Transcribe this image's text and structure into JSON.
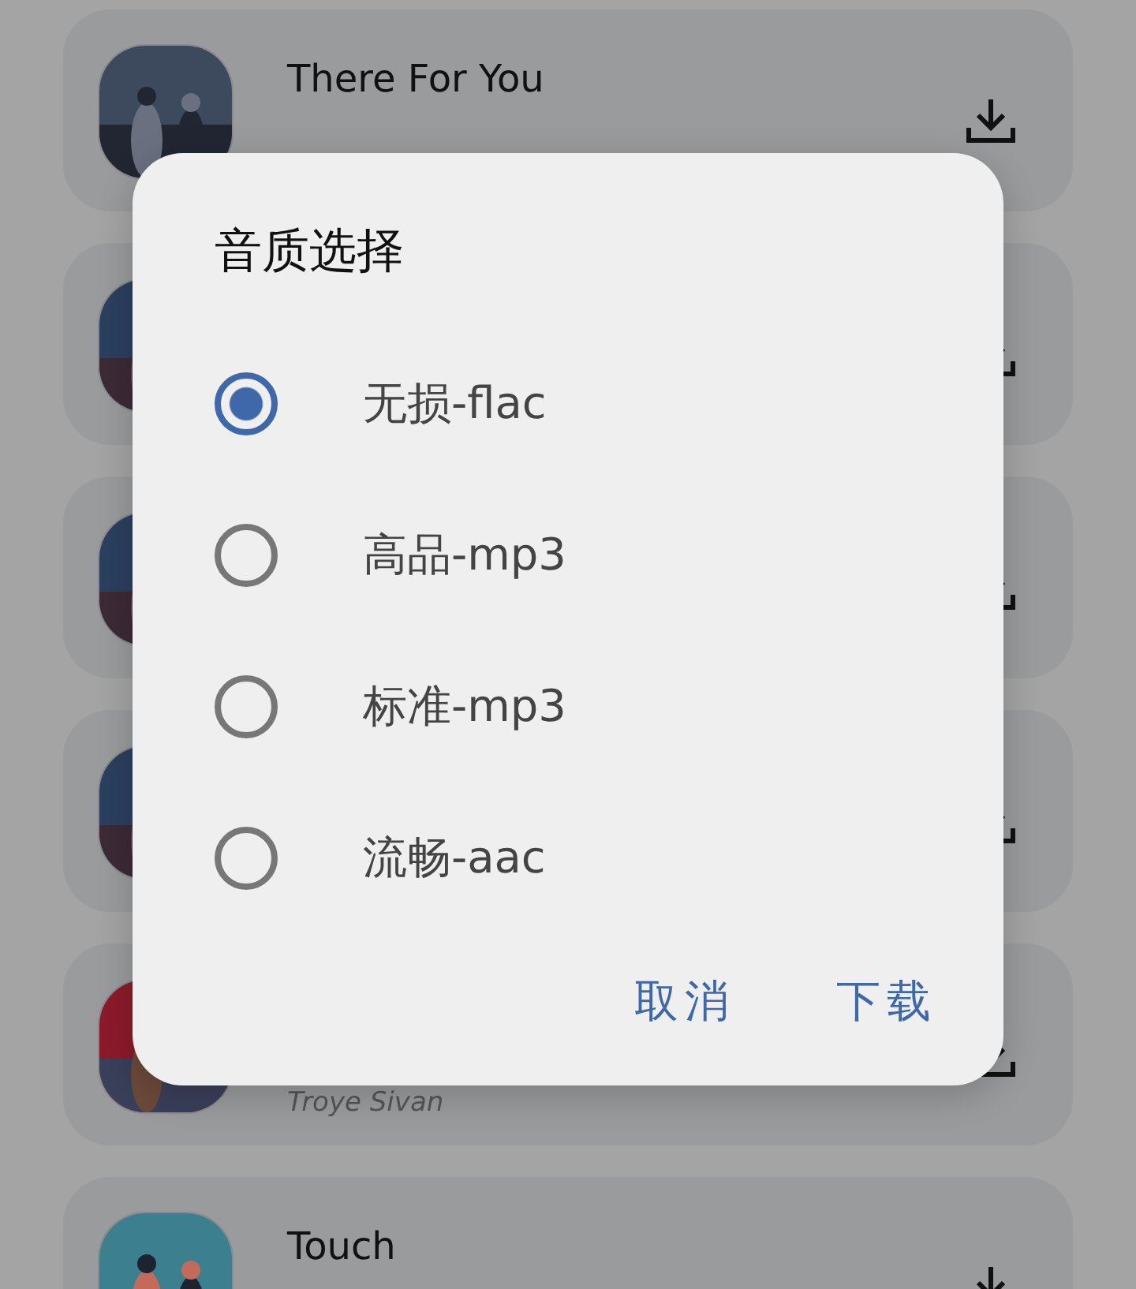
{
  "songs": [
    {
      "title": "There For You",
      "cover": {
        "kind": "picture"
      }
    },
    {
      "cover": {
        "kind": "picture"
      }
    },
    {
      "cover": {
        "kind": "picture"
      }
    },
    {
      "cover": {
        "kind": "picture"
      }
    },
    {
      "artist": "Troye Sivan",
      "cover": {
        "kind": "picture"
      }
    },
    {
      "title": "Touch",
      "cover": {
        "kind": "picture"
      }
    }
  ],
  "dialog": {
    "title": "音质选择",
    "options": [
      {
        "label": "无损-flac",
        "selected": true
      },
      {
        "label": "高品-mp3",
        "selected": false
      },
      {
        "label": "标准-mp3",
        "selected": false
      },
      {
        "label": "流畅-aac",
        "selected": false
      }
    ],
    "buttons": [
      "取消",
      "下载"
    ]
  }
}
